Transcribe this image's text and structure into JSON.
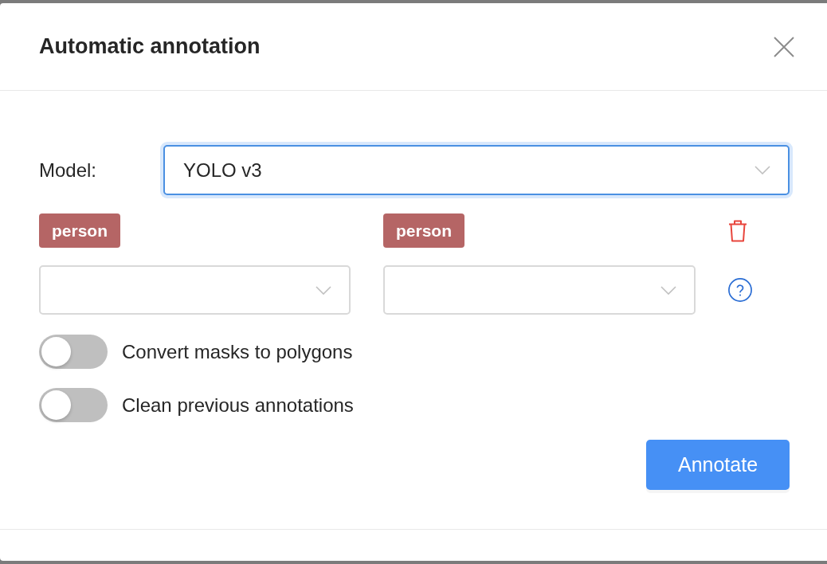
{
  "dialog": {
    "title": "Automatic annotation"
  },
  "model": {
    "label": "Model:",
    "value": "YOLO v3",
    "focused": true
  },
  "mappings": [
    {
      "model_label": "person",
      "task_label": "person"
    }
  ],
  "new_mapping": {
    "selects": [
      {
        "focused": false
      },
      {
        "focused": false
      }
    ]
  },
  "options": [
    {
      "label": "Convert masks to polygons",
      "on": false
    },
    {
      "label": "Clean previous annotations",
      "on": false
    }
  ],
  "submit": {
    "label": "Annotate"
  }
}
